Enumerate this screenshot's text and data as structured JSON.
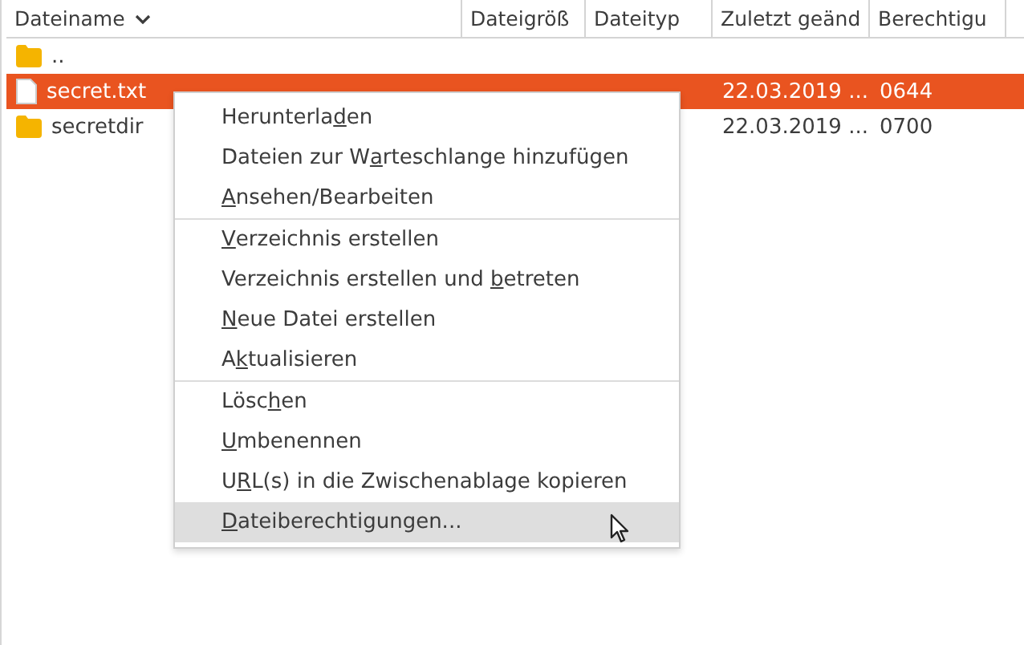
{
  "columns": [
    {
      "label": "Dateiname",
      "sorted": true
    },
    {
      "label": "Dateigröß",
      "sorted": false
    },
    {
      "label": "Dateityp",
      "sorted": false
    },
    {
      "label": "Zuletzt geänd",
      "sorted": false
    },
    {
      "label": "Berechtigu",
      "sorted": false
    }
  ],
  "rows": [
    {
      "kind": "folder",
      "name": "..",
      "selected": false
    },
    {
      "kind": "file",
      "name": "secret.txt",
      "modified": "22.03.2019 ...",
      "permissions": "0644",
      "selected": true
    },
    {
      "kind": "folder",
      "name": "secretdir",
      "modified": "22.03.2019 ...",
      "permissions": "0700",
      "selected": false
    }
  ],
  "context_menu": [
    [
      {
        "label": {
          "pre": "Herunterla",
          "key": "d",
          "post": "en"
        },
        "selected": false
      },
      {
        "label": {
          "pre": "Dateien zur W",
          "key": "a",
          "post": "rteschlange hinzufügen"
        },
        "selected": false
      },
      {
        "label": {
          "key": "A",
          "post": "nsehen/Bearbeiten"
        },
        "selected": false
      }
    ],
    [
      {
        "label": {
          "key": "V",
          "post": "erzeichnis erstellen"
        },
        "selected": false
      },
      {
        "label": {
          "pre": "Verzeichnis erstellen und ",
          "key": "b",
          "post": "etreten"
        },
        "selected": false
      },
      {
        "label": {
          "key": "N",
          "post": "eue Datei erstellen"
        },
        "selected": false
      },
      {
        "label": {
          "pre": "A",
          "key": "k",
          "post": "tualisieren"
        },
        "selected": false
      }
    ],
    [
      {
        "label": {
          "pre": "Lösc",
          "key": "h",
          "post": "en"
        },
        "selected": false
      },
      {
        "label": {
          "key": "U",
          "post": "mbenennen"
        },
        "selected": false
      },
      {
        "label": {
          "pre": "U",
          "key": "R",
          "post": "L(s) in die Zwischenablage kopieren"
        },
        "selected": false
      },
      {
        "label": {
          "key": "D",
          "post": "ateiberechtigungen..."
        },
        "selected": true
      }
    ]
  ]
}
